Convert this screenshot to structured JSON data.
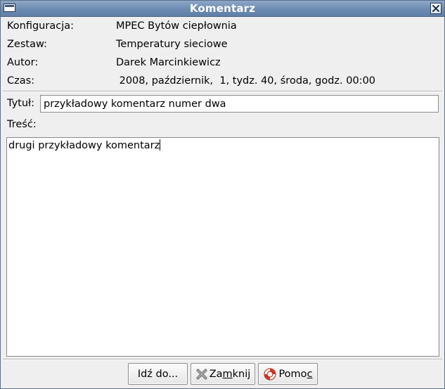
{
  "window": {
    "title": "Komentarz"
  },
  "info": {
    "rows": [
      {
        "label": "Konfiguracja:",
        "value": "MPEC Bytów ciepłownia"
      },
      {
        "label": "Zestaw:",
        "value": "Temperatury sieciowe"
      },
      {
        "label": "Autor:",
        "value": "Darek Marcinkiewicz"
      },
      {
        "label": "Czas:",
        "value": " 2008, październik,  1, tydz. 40, środa, godz. 00:00"
      }
    ]
  },
  "form": {
    "title_label": "Tytuł:",
    "title_value": "przykładowy komentarz numer dwa",
    "body_label": "Treść:",
    "body_value": "drugi przykładowy komentarz"
  },
  "buttons": {
    "goto": {
      "label": "Idź do..."
    },
    "close": {
      "pre": "Za",
      "mnemonic": "m",
      "post": "knij",
      "icon": "close-x-icon"
    },
    "help": {
      "pre": "Pomo",
      "mnemonic": "c",
      "post": "",
      "icon": "lifebuoy-icon"
    }
  },
  "colors": {
    "titlebar": "#6d8bb1",
    "window_bg": "#efefef"
  }
}
